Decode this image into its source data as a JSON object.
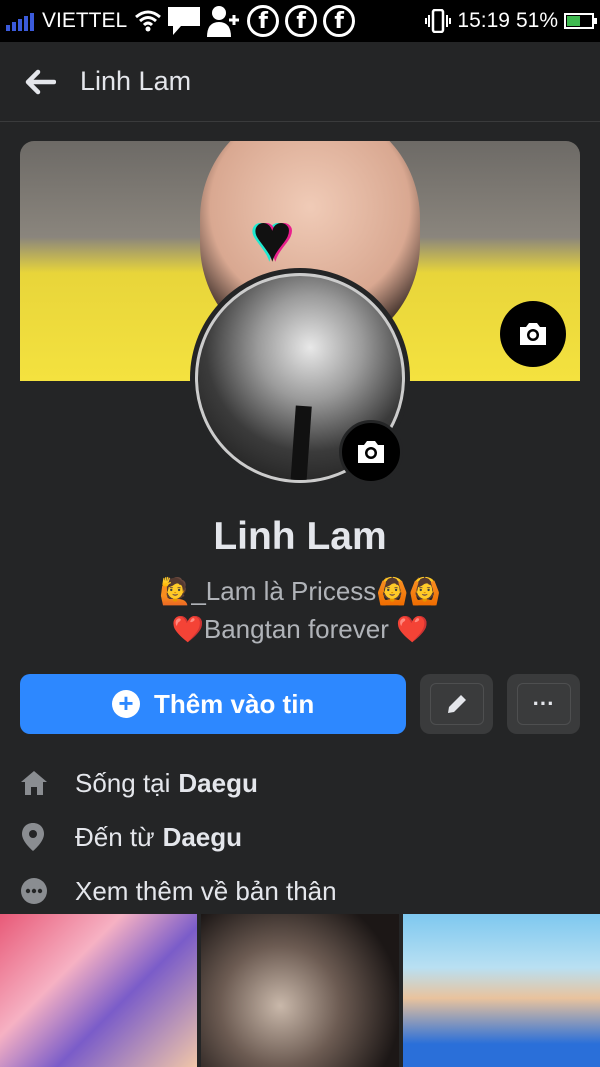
{
  "status_bar": {
    "carrier": "VIETTEL",
    "time": "15:19",
    "battery": "51%",
    "battery_level": 0.51,
    "icons": [
      "signal-icon",
      "wifi-icon",
      "message-icon",
      "add-contact-icon",
      "facebook-icon",
      "facebook-icon",
      "facebook-icon",
      "vibrate-icon",
      "battery-icon"
    ]
  },
  "header": {
    "title": "Linh Lam"
  },
  "profile": {
    "name": "Linh Lam",
    "bio_line1": "🙋_Lam là Pricess🙆🙆",
    "bio_line2": "❤️Bangtan forever ❤️"
  },
  "actions": {
    "add_story": "Thêm vào tin",
    "more": "···"
  },
  "info": {
    "lives_in_prefix": "Sống tại",
    "lives_in_city": "Daegu",
    "from_prefix": "Đến từ",
    "from_city": "Daegu",
    "see_more": "Xem thêm về bản thân"
  },
  "colors": {
    "background": "#242526",
    "primary": "#2d88ff",
    "secondary_button": "#3a3b3c",
    "text": "#e4e6eb",
    "muted_text": "#b0b3b8"
  }
}
